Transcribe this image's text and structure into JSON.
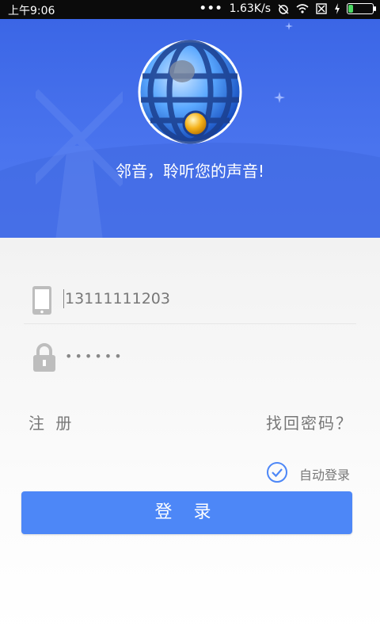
{
  "status_bar": {
    "time": "上午9:06",
    "network_speed": "1.63K/s",
    "icons": [
      "more-dots-icon",
      "alarm-off-icon",
      "wifi-icon",
      "sim-off-icon",
      "charging-icon",
      "battery-icon"
    ]
  },
  "banner": {
    "slogan": "邻音，聆听您的声音!",
    "logo_icon": "globe-logo-icon"
  },
  "login_form": {
    "phone": {
      "value": "13111111203",
      "icon": "phone-icon"
    },
    "password": {
      "masked_value": "••••••",
      "icon": "lock-icon"
    },
    "register_link": "注 册",
    "forgot_link": "找回密码？",
    "auto_login": {
      "label": "自动登录",
      "checked": true
    },
    "login_button": "登 录"
  },
  "colors": {
    "banner_blue": "#4a74ee",
    "button_blue": "#4d87f7",
    "check_blue": "#4d87f7",
    "text_gray": "#777777"
  }
}
